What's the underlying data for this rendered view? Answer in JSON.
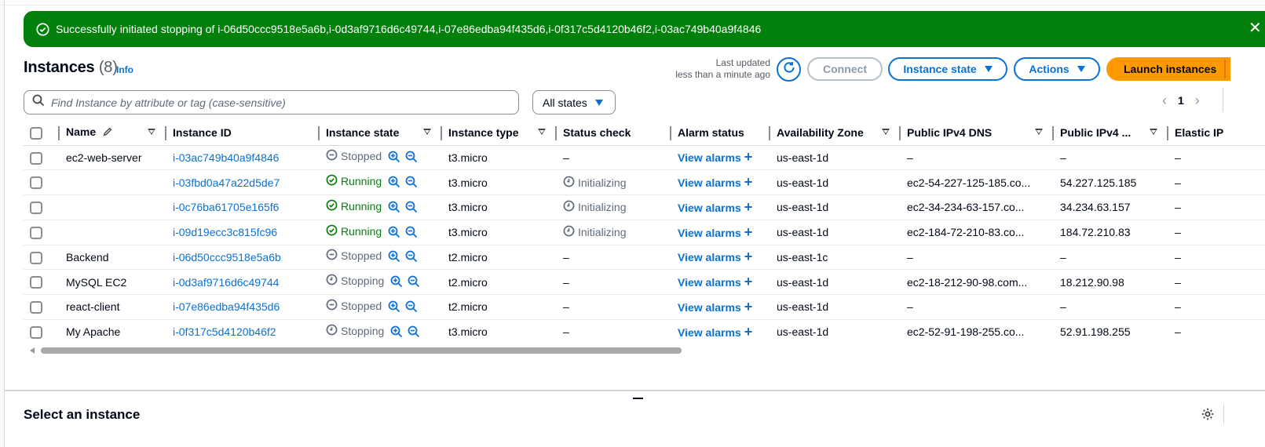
{
  "flash": {
    "message": "Successfully initiated stopping of i-06d50ccc9518e5a6b,i-0d3af9716d6c49744,i-07e86edba94f435d6,i-0f317c5d4120b46f2,i-03ac749b40a9f4846",
    "close": "✕"
  },
  "header": {
    "title": "Instances",
    "count": "(8)",
    "info": "Info",
    "last_updated_line1": "Last updated",
    "last_updated_line2": "less than a minute ago",
    "connect": "Connect",
    "instance_state": "Instance state",
    "actions": "Actions",
    "launch": "Launch instances"
  },
  "filter": {
    "placeholder": "Find Instance by attribute or tag (case-sensitive)",
    "states": "All states"
  },
  "pager": {
    "prev": "‹",
    "page": "1",
    "next": "›"
  },
  "columns": {
    "name": "Name",
    "id": "Instance ID",
    "state": "Instance state",
    "type": "Instance type",
    "status": "Status check",
    "alarm": "Alarm status",
    "az": "Availability Zone",
    "dns": "Public IPv4 DNS",
    "ip": "Public IPv4 ...",
    "eip": "Elastic IP"
  },
  "rows": [
    {
      "name": "ec2-web-server",
      "id": "i-03ac749b40a9f4846",
      "state": "Stopped",
      "type": "t3.micro",
      "status": "–",
      "alarm": "View alarms",
      "az": "us-east-1d",
      "dns": "–",
      "ip": "–",
      "eip": "–"
    },
    {
      "name": "",
      "id": "i-03fbd0a47a22d5de7",
      "state": "Running",
      "type": "t3.micro",
      "status": "Initializing",
      "alarm": "View alarms",
      "az": "us-east-1d",
      "dns": "ec2-54-227-125-185.co...",
      "ip": "54.227.125.185",
      "eip": "–"
    },
    {
      "name": "",
      "id": "i-0c76ba61705e165f6",
      "state": "Running",
      "type": "t3.micro",
      "status": "Initializing",
      "alarm": "View alarms",
      "az": "us-east-1d",
      "dns": "ec2-34-234-63-157.co...",
      "ip": "34.234.63.157",
      "eip": "–"
    },
    {
      "name": "",
      "id": "i-09d19ecc3c815fc96",
      "state": "Running",
      "type": "t3.micro",
      "status": "Initializing",
      "alarm": "View alarms",
      "az": "us-east-1d",
      "dns": "ec2-184-72-210-83.co...",
      "ip": "184.72.210.83",
      "eip": "–"
    },
    {
      "name": "Backend",
      "id": "i-06d50ccc9518e5a6b",
      "state": "Stopped",
      "type": "t2.micro",
      "status": "–",
      "alarm": "View alarms",
      "az": "us-east-1c",
      "dns": "–",
      "ip": "–",
      "eip": "–"
    },
    {
      "name": "MySQL EC2",
      "id": "i-0d3af9716d6c49744",
      "state": "Stopping",
      "type": "t2.micro",
      "status": "–",
      "alarm": "View alarms",
      "az": "us-east-1d",
      "dns": "ec2-18-212-90-98.com...",
      "ip": "18.212.90.98",
      "eip": "–"
    },
    {
      "name": "react-client",
      "id": "i-07e86edba94f435d6",
      "state": "Stopped",
      "type": "t2.micro",
      "status": "–",
      "alarm": "View alarms",
      "az": "us-east-1d",
      "dns": "–",
      "ip": "–",
      "eip": "–"
    },
    {
      "name": "My Apache",
      "id": "i-0f317c5d4120b46f2",
      "state": "Stopping",
      "type": "t3.micro",
      "status": "–",
      "alarm": "View alarms",
      "az": "us-east-1d",
      "dns": "ec2-52-91-198-255.co...",
      "ip": "52.91.198.255",
      "eip": "–"
    }
  ],
  "split": {
    "title": "Select an instance"
  },
  "colors": {
    "accent": "#0972d3",
    "success": "#037f0c",
    "launch": "#ff9900",
    "muted": "#5f6b7a"
  },
  "icons": {
    "stopped": "stopped-circle-icon",
    "running": "check-circle-icon",
    "stopping": "clock-icon",
    "initializing": "clock-icon",
    "zoom_in": "zoom-in-icon",
    "zoom_out": "zoom-out-icon"
  }
}
